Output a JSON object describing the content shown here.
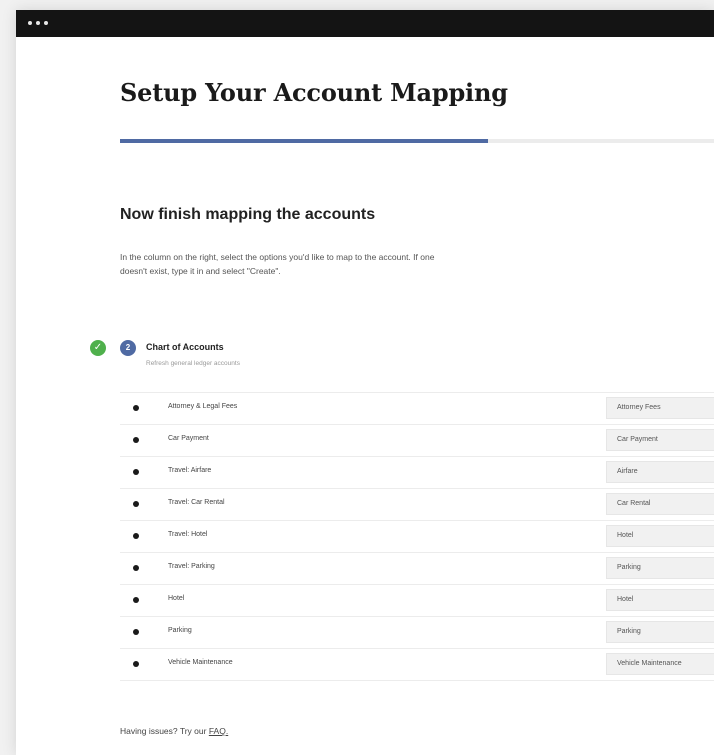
{
  "header": {
    "title": "Setup Your Account Mapping",
    "progress_percent": 62
  },
  "section": {
    "heading": "Now finish mapping the accounts",
    "description": "In the column on the right, select the options you'd like to map to the account. If one doesn't exist, type it in and select \"Create\"."
  },
  "step": {
    "check_icon": "✓",
    "number": "2",
    "title": "Chart of Accounts",
    "subtitle": "Refresh general ledger accounts"
  },
  "accounts": [
    {
      "name": "Attorney & Legal Fees",
      "mapped": "Attorney Fees"
    },
    {
      "name": "Car Payment",
      "mapped": "Car Payment"
    },
    {
      "name": "Travel: Airfare",
      "mapped": "Airfare"
    },
    {
      "name": "Travel: Car Rental",
      "mapped": "Car Rental"
    },
    {
      "name": "Travel: Hotel",
      "mapped": "Hotel"
    },
    {
      "name": "Travel: Parking",
      "mapped": "Parking"
    },
    {
      "name": "Hotel",
      "mapped": "Hotel"
    },
    {
      "name": "Parking",
      "mapped": "Parking"
    },
    {
      "name": "Vehicle Maintenance",
      "mapped": "Vehicle Maintenance"
    }
  ],
  "footer": {
    "help_text": "Having issues? Try our ",
    "help_link": "FAQ."
  },
  "colors": {
    "accent": "#4f6aa3",
    "success": "#4fb04c",
    "titlebar": "#141414"
  }
}
